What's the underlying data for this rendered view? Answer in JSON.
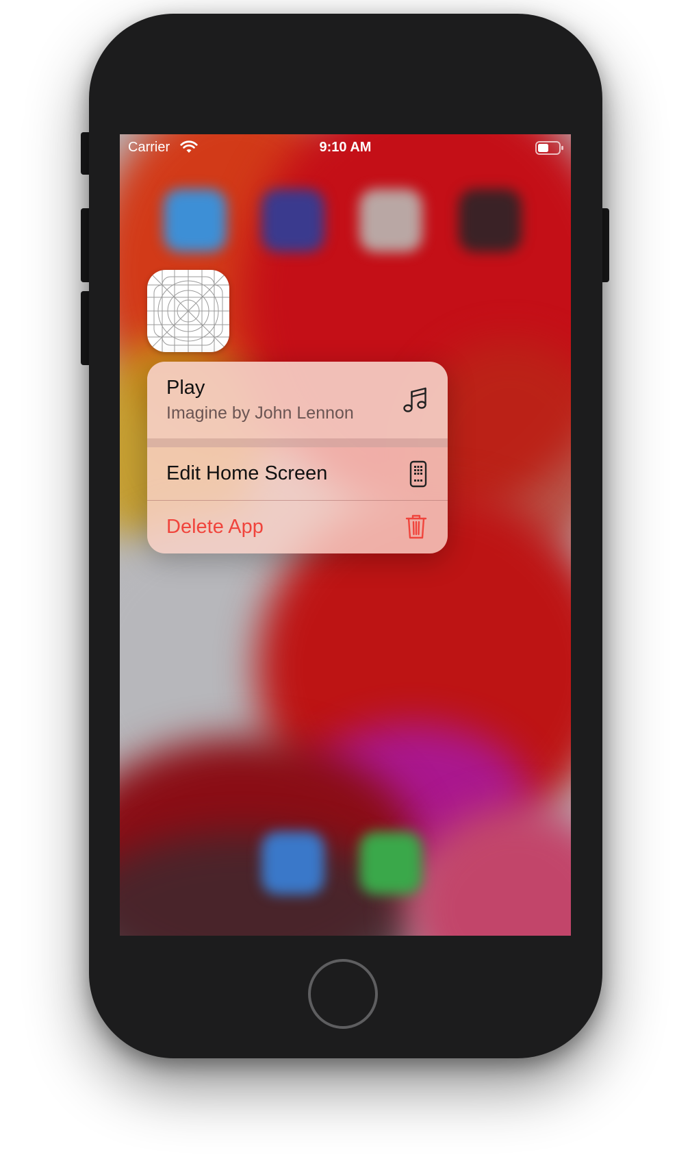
{
  "status_bar": {
    "carrier": "Carrier",
    "time": "9:10 AM",
    "wifi_icon": "wifi-icon",
    "battery_icon": "battery-icon"
  },
  "app_icon": {
    "icon": "app-icon-template-grid"
  },
  "context_menu": {
    "items": [
      {
        "title": "Play",
        "subtitle": "Imagine by John Lennon",
        "icon": "music-note-icon"
      },
      {
        "title": "Edit Home Screen",
        "icon": "phone-apps-icon"
      },
      {
        "title": "Delete App",
        "icon": "trash-icon",
        "color": "#f0443c"
      }
    ]
  },
  "colors": {
    "destructive": "#f0443c",
    "wallpaper_red": "#c40f17",
    "phone_body": "#1c1c1d"
  }
}
